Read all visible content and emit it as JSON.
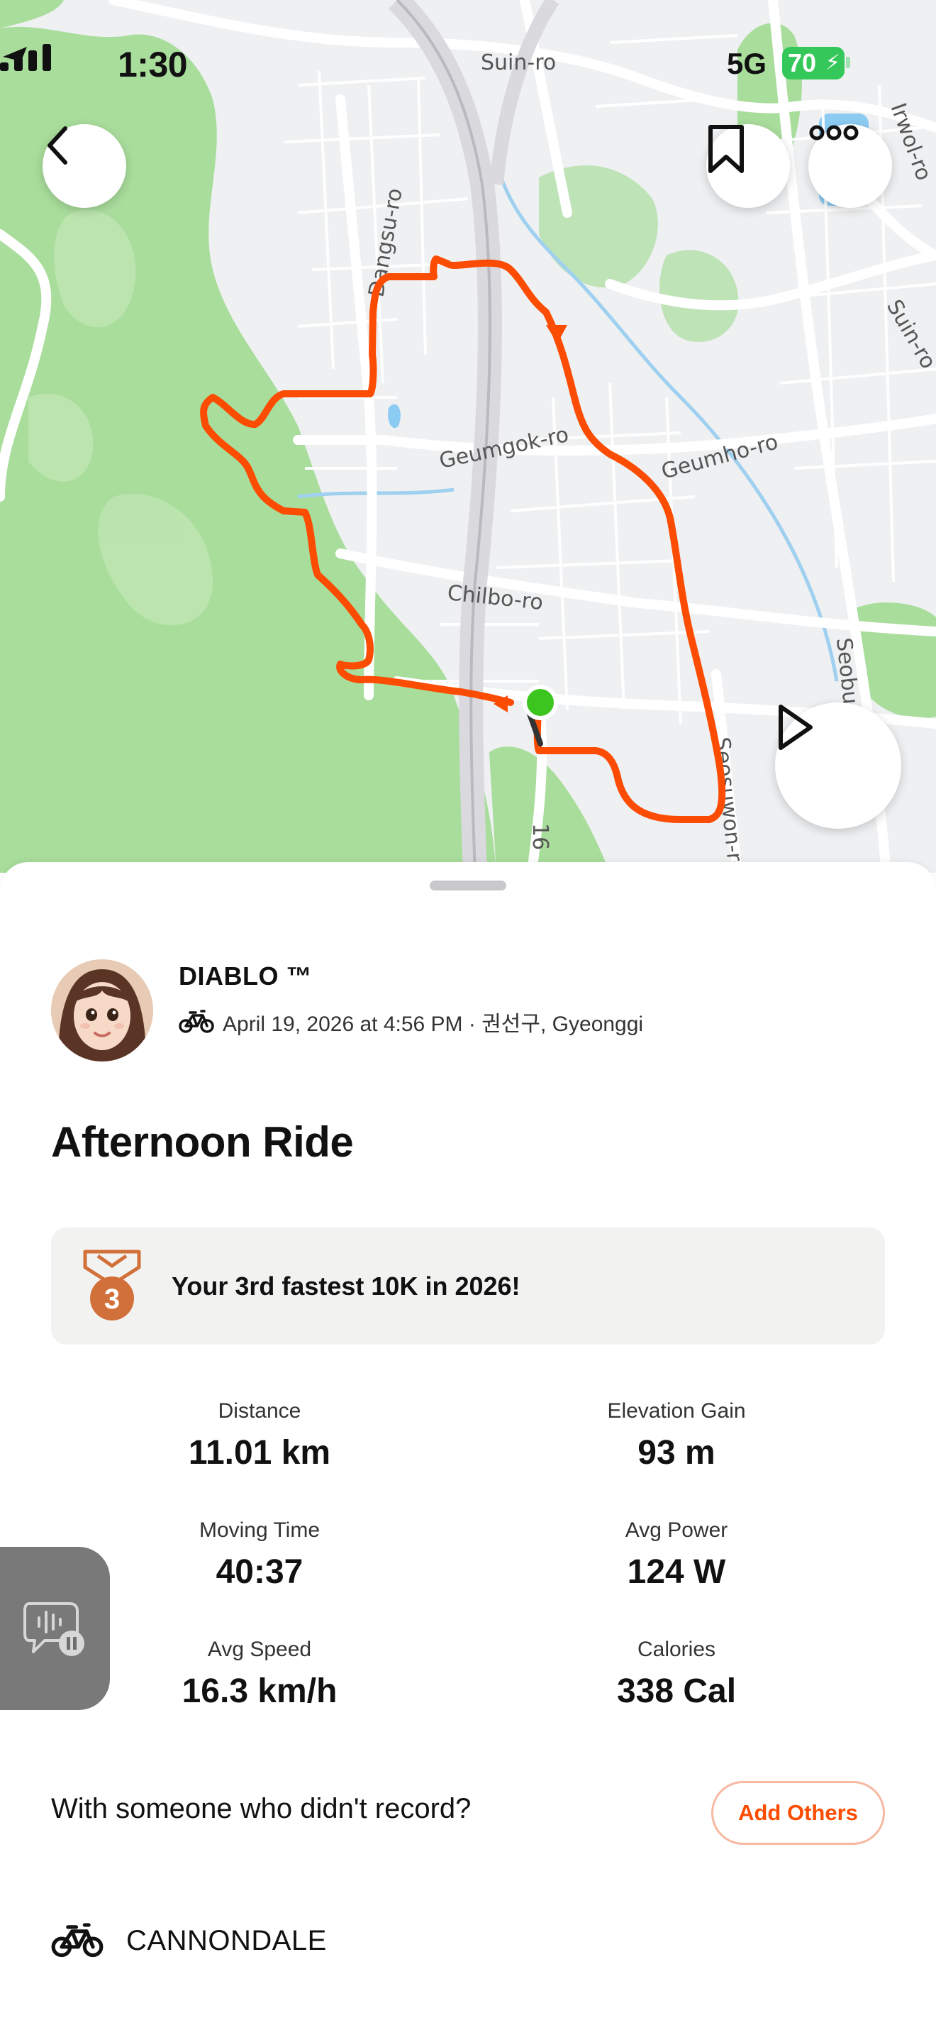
{
  "status_bar": {
    "time": "1:30",
    "network": "5G",
    "battery": "70"
  },
  "map": {
    "road_labels": [
      "Suin-ro",
      "Dangsu-ro",
      "Geumgok-ro",
      "Geumho-ro",
      "Chilbo-ro",
      "Seosuwon-ro",
      "Suin-ro",
      "Irwol-ro",
      "Seobu",
      "16"
    ],
    "route_color": "#fc4c02",
    "start_color": "#3cc51f",
    "park_color": "#a9dd9c"
  },
  "activity": {
    "athlete_name": "DIABLO ™",
    "meta": "April 19, 2026 at 4:56 PM · 권선구, Gyeonggi",
    "title": "Afternoon Ride",
    "achievement": {
      "rank": "3",
      "text": "Your 3rd fastest 10K in 2026!"
    },
    "stats": [
      {
        "label": "Distance",
        "value": "11.01 km"
      },
      {
        "label": "Elevation Gain",
        "value": "93 m"
      },
      {
        "label": "Moving Time",
        "value": "40:37"
      },
      {
        "label": "Avg Power",
        "value": "124 W"
      },
      {
        "label": "Avg Speed",
        "value": "16.3 km/h"
      },
      {
        "label": "Calories",
        "value": "338 Cal"
      }
    ],
    "with_prompt": "With someone who didn't record?",
    "add_others_label": "Add Others",
    "gear": "CANNONDALE"
  },
  "colors": {
    "accent": "#fc4c02",
    "achievement_bg": "#f2f2f1",
    "medal": "#d2703a"
  }
}
